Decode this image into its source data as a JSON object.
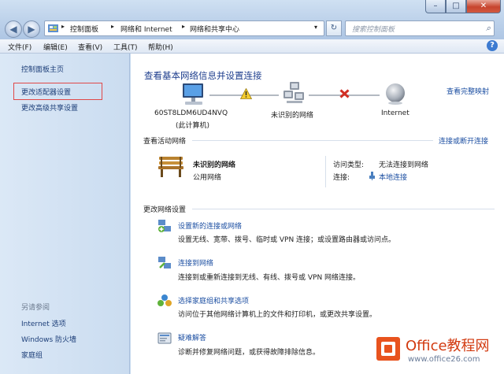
{
  "window": {
    "minimize_glyph": "–",
    "maximize_glyph": "□",
    "close_glyph": "✕"
  },
  "address_bar": {
    "crumbs": [
      "控制面板",
      "网络和 Internet",
      "网络和共享中心"
    ],
    "refresh_glyph": "↻",
    "search_placeholder": "搜索控制面板"
  },
  "menu": {
    "items": [
      "文件(F)",
      "编辑(E)",
      "查看(V)",
      "工具(T)",
      "帮助(H)"
    ]
  },
  "sidebar": {
    "links": [
      "控制面板主页",
      "更改适配器设置",
      "更改高级共享设置"
    ],
    "see_also_title": "另请参阅",
    "see_also_links": [
      "Internet 选项",
      "Windows 防火墙",
      "家庭组"
    ]
  },
  "main": {
    "title": "查看基本网络信息并设置连接",
    "full_map_link": "查看完整映射",
    "map": {
      "computer_name": "60ST8LDM6UD4NVQ",
      "computer_sub": "(此计算机)",
      "network_label": "未识别的网络",
      "internet_label": "Internet"
    },
    "active_networks": {
      "heading": "查看活动网络",
      "connect_link": "连接或断开连接",
      "network_name": "未识别的网络",
      "network_type": "公用网络",
      "access_type_label": "访问类型:",
      "access_type_value": "无法连接到网络",
      "connection_label": "连接:",
      "connection_value": "本地连接"
    },
    "change_settings": {
      "heading": "更改网络设置",
      "tasks": [
        {
          "link": "设置新的连接或网络",
          "desc": "设置无线、宽带、拨号、临时或 VPN 连接；或设置路由器或访问点。"
        },
        {
          "link": "连接到网络",
          "desc": "连接到或重新连接到无线、有线、拨号或 VPN 网络连接。"
        },
        {
          "link": "选择家庭组和共享选项",
          "desc": "访问位于其他网络计算机上的文件和打印机，或更改共享设置。"
        },
        {
          "link": "疑难解答",
          "desc": "诊断并修复网络问题，或获得故障排除信息。"
        }
      ]
    }
  },
  "watermark": {
    "brand": "Office教程网",
    "url": "www.office26.com"
  }
}
